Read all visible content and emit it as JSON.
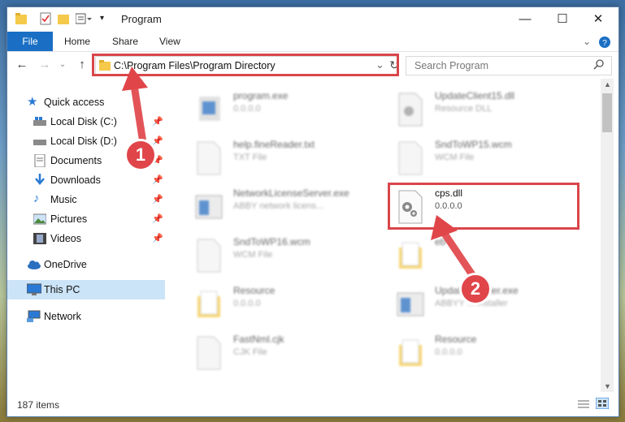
{
  "window": {
    "title": "Program"
  },
  "ribbon": {
    "file": "File",
    "tabs": [
      "Home",
      "Share",
      "View"
    ]
  },
  "address": {
    "path": "C:\\Program Files\\Program Directory",
    "search_placeholder": "Search Program"
  },
  "sidebar": {
    "quick_access": "Quick access",
    "items": [
      "Local Disk (C:)",
      "Local Disk (D:)",
      "Documents",
      "Downloads",
      "Music",
      "Pictures",
      "Videos"
    ],
    "onedrive": "OneDrive",
    "thispc": "This PC",
    "network": "Network"
  },
  "files": [
    {
      "name": "program.exe",
      "sub": "0.0.0.0"
    },
    {
      "name": "UpdateClient15.dll",
      "sub": "Resource DLL"
    },
    {
      "name": "help.fineReader.txt",
      "sub": "TXT File"
    },
    {
      "name": "SndToWP15.wcm",
      "sub": "WCM File"
    },
    {
      "name": "NetworkLicenseServer.exe",
      "sub": "ABBY network licens..."
    },
    {
      "name": "cps.dll",
      "sub": "0.0.0.0",
      "sub2": "-"
    },
    {
      "name": "SndToWP16.wcm",
      "sub": "WCM File"
    },
    {
      "name": "eb",
      "sub": ""
    },
    {
      "name": "Resource",
      "sub": "0.0.0.0"
    },
    {
      "name": "UpdateInstaller.exe",
      "sub": "ABBYY ... installer"
    },
    {
      "name": "FastNml.cjk",
      "sub": "CJK File"
    },
    {
      "name": "Resource",
      "sub": "0.0.0.0"
    }
  ],
  "status": {
    "count": "187 items"
  },
  "annotations": {
    "step1": "1",
    "step2": "2"
  },
  "colors": {
    "accent": "#1a6fc4",
    "annotation": "#d9464a"
  }
}
